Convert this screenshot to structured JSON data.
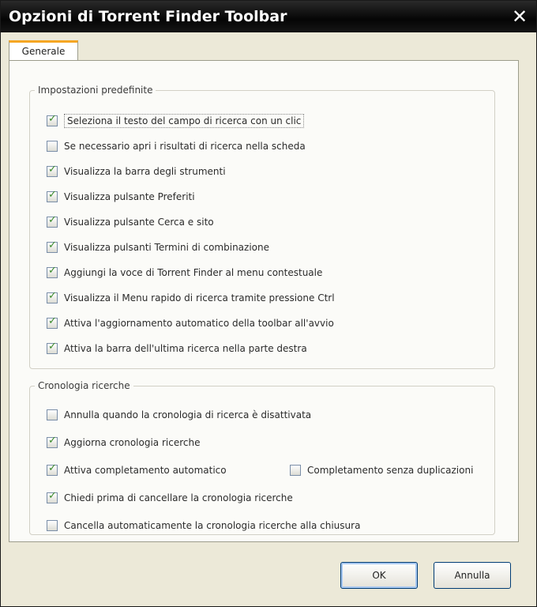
{
  "window": {
    "title": "Opzioni di Torrent Finder Toolbar"
  },
  "tab": {
    "label": "Generale"
  },
  "group1": {
    "legend": "Impostazioni predefinite",
    "items": [
      {
        "label": "Seleziona il testo del campo di ricerca con un clic",
        "checked": true
      },
      {
        "label": "Se necessario apri i risultati di ricerca nella scheda",
        "checked": false
      },
      {
        "label": "Visualizza la barra degli strumenti",
        "checked": true
      },
      {
        "label": "Visualizza pulsante Preferiti",
        "checked": true
      },
      {
        "label": "Visualizza pulsante Cerca e sito",
        "checked": true
      },
      {
        "label": "Visualizza pulsanti Termini di combinazione",
        "checked": true
      },
      {
        "label": "Aggiungi la voce di Torrent Finder al menu contestuale",
        "checked": true
      },
      {
        "label": "Visualizza il Menu rapido di ricerca tramite pressione Ctrl",
        "checked": true
      },
      {
        "label": "Attiva l'aggiornamento automatico della toolbar all'avvio",
        "checked": true
      },
      {
        "label": "Attiva la barra dell'ultima ricerca nella parte destra",
        "checked": true
      }
    ]
  },
  "group2": {
    "legend": "Cronologia ricerche",
    "items": [
      {
        "label": "Annulla quando la cronologia di ricerca è disattivata",
        "checked": false
      },
      {
        "label": "Aggiorna cronologia ricerche",
        "checked": true
      },
      {
        "label": "Attiva completamento automatico",
        "checked": true
      },
      {
        "label": "Chiedi prima di cancellare la cronologia ricerche",
        "checked": true
      },
      {
        "label": "Cancella automaticamente la cronologia ricerche alla chiusura",
        "checked": false
      }
    ],
    "inline_item": {
      "label": "Completamento senza duplicazioni",
      "checked": false
    }
  },
  "buttons": {
    "ok": "OK",
    "cancel": "Annulla"
  }
}
